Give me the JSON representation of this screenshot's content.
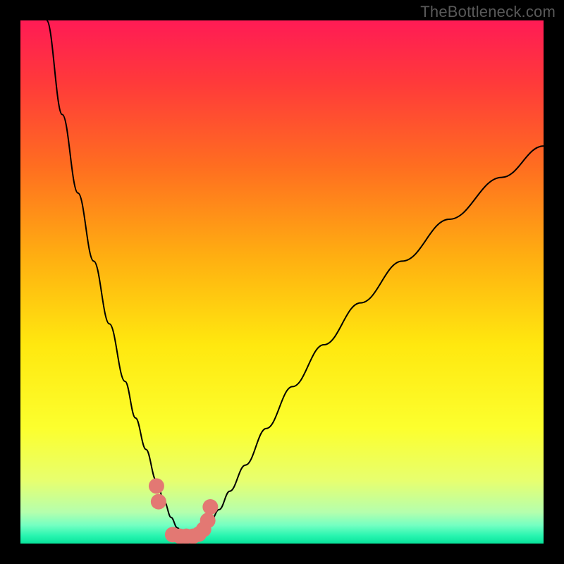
{
  "watermark": "TheBottleneck.com",
  "chart_data": {
    "type": "line",
    "title": "",
    "xlabel": "",
    "ylabel": "",
    "xlim": [
      0,
      100
    ],
    "ylim": [
      0,
      100
    ],
    "background_gradient": {
      "type": "vertical",
      "stops": [
        {
          "pos": 0.0,
          "color": "#ff1b55"
        },
        {
          "pos": 0.12,
          "color": "#ff3a3a"
        },
        {
          "pos": 0.28,
          "color": "#ff6e20"
        },
        {
          "pos": 0.45,
          "color": "#ffae11"
        },
        {
          "pos": 0.62,
          "color": "#ffe80f"
        },
        {
          "pos": 0.78,
          "color": "#fcff2e"
        },
        {
          "pos": 0.88,
          "color": "#e7ff6f"
        },
        {
          "pos": 0.94,
          "color": "#b5ffad"
        },
        {
          "pos": 0.965,
          "color": "#74ffc2"
        },
        {
          "pos": 0.985,
          "color": "#28f5b0"
        },
        {
          "pos": 1.0,
          "color": "#08e39a"
        }
      ]
    },
    "series": [
      {
        "name": "curve",
        "stroke": "#000000",
        "x": [
          5,
          8,
          11,
          14,
          17,
          20,
          22,
          24,
          26,
          27.5,
          28.8,
          30,
          31,
          32,
          33,
          34,
          36,
          38,
          40,
          43,
          47,
          52,
          58,
          65,
          73,
          82,
          92,
          100
        ],
        "y": [
          100,
          82,
          67,
          54,
          42,
          31,
          24,
          18,
          12,
          8,
          5,
          3,
          1.8,
          1.4,
          1.4,
          1.8,
          3.5,
          6.5,
          10,
          15,
          22,
          30,
          38,
          46,
          54,
          62,
          70,
          76
        ]
      }
    ],
    "markers": {
      "name": "points",
      "fill": "#e37873",
      "r": 11,
      "x": [
        26.0,
        26.4,
        29.1,
        30.5,
        31.7,
        33.0,
        34.1,
        35.0,
        35.8,
        36.3
      ],
      "y": [
        11.0,
        8.0,
        1.7,
        1.4,
        1.4,
        1.4,
        1.8,
        2.7,
        4.4,
        7.0
      ]
    }
  }
}
